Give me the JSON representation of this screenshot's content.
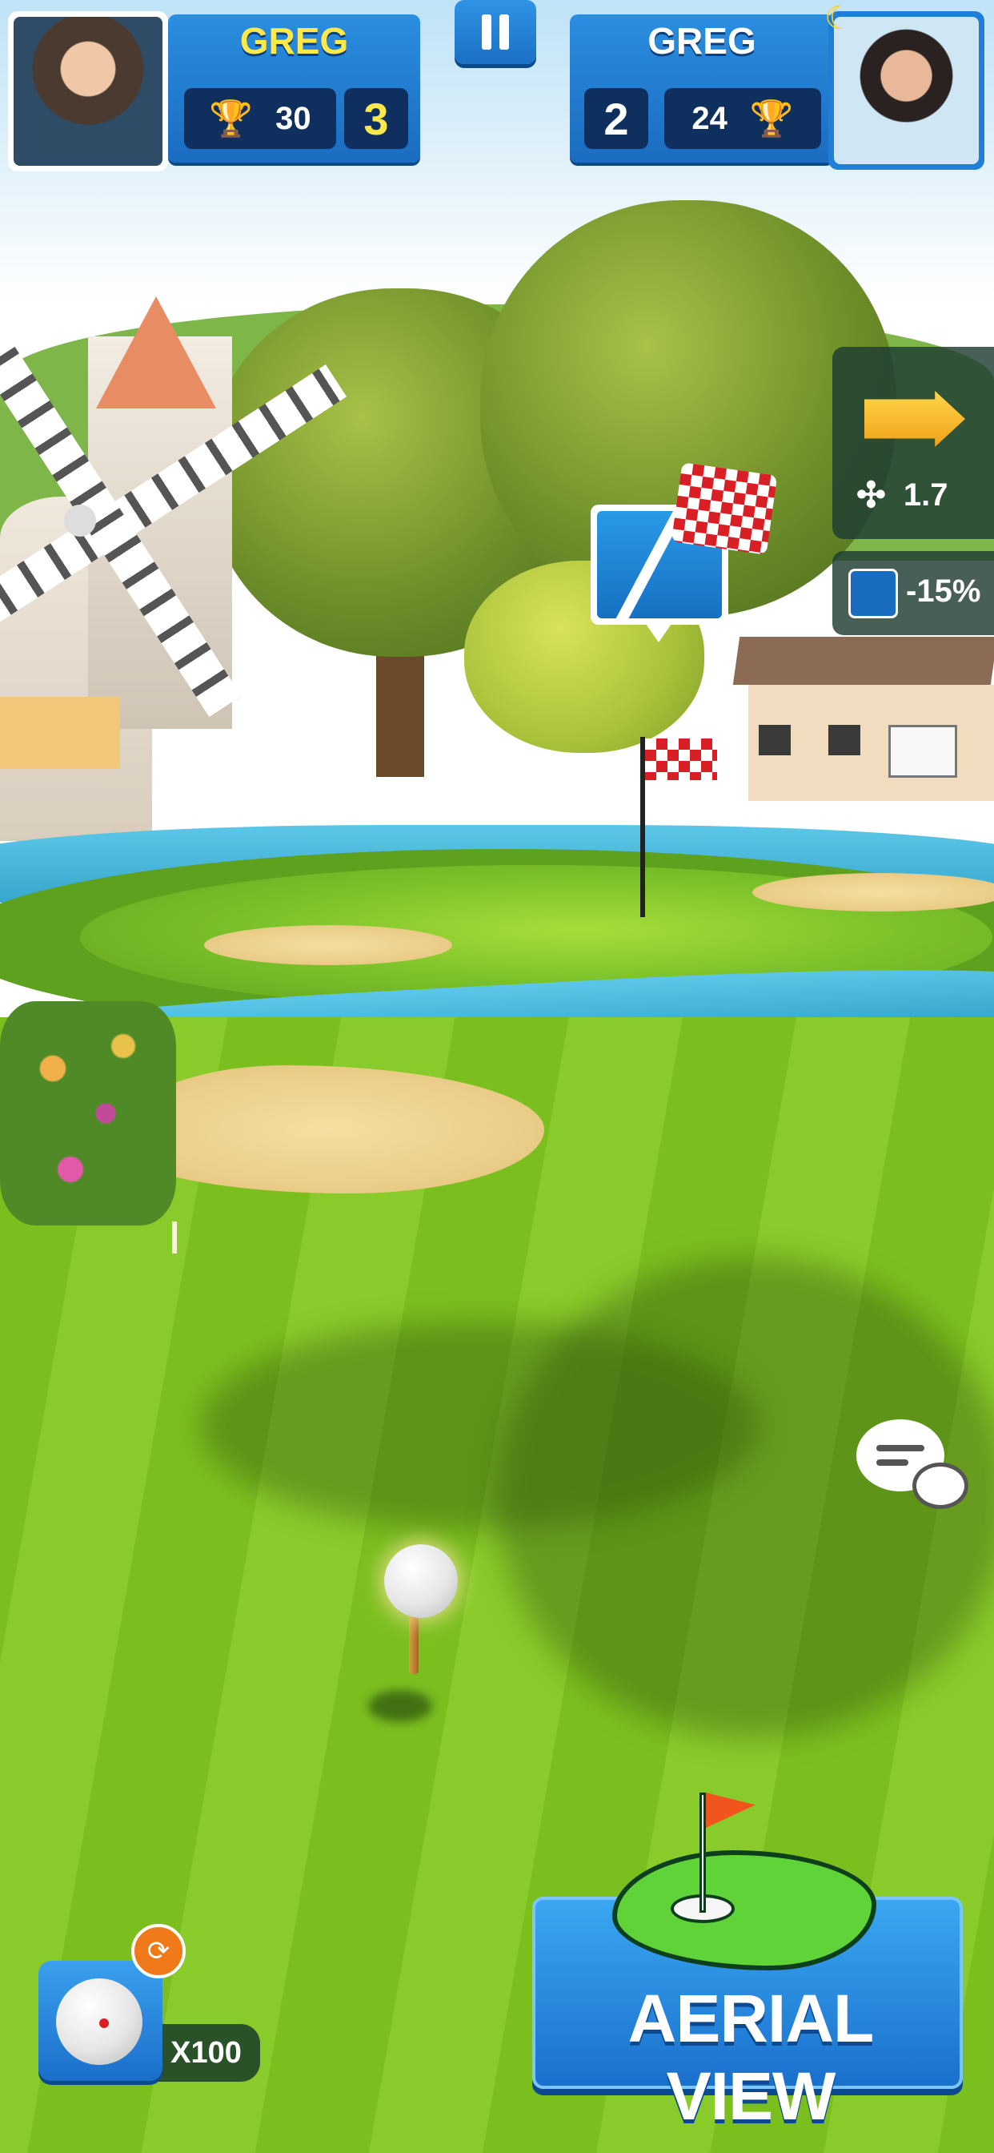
{
  "hud": {
    "player_left": {
      "name": "GREG",
      "trophies": "30",
      "score": "3"
    },
    "player_right": {
      "name": "GREG",
      "trophies": "24",
      "score": "2"
    }
  },
  "wind": {
    "speed": "1.7",
    "icon": "wind-fan-icon",
    "arrow_icon": "direction-arrow-icon"
  },
  "modifier": {
    "value": "-15%",
    "icon": "spin-modifier-icon"
  },
  "ball": {
    "count": "X100",
    "icon": "golf-ball-icon"
  },
  "aerial_view": {
    "label": "AERIAL VIEW"
  },
  "colors": {
    "hud_blue": "#1a6cc0",
    "hud_dark": "#0f2f5e",
    "name_yellow": "#ffe94a",
    "trophy_gold": "#ffd21a",
    "flag_red": "#d81f26",
    "fairway_green": "#7bbf1f"
  }
}
